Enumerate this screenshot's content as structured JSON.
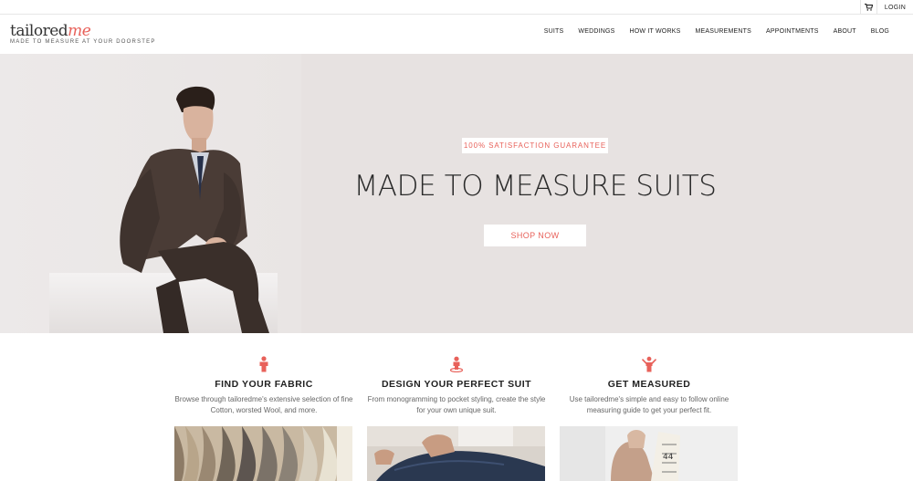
{
  "topbar": {
    "login": "LOGIN"
  },
  "header": {
    "logo_main": "tailored",
    "logo_accent": "me",
    "tagline": "MADE TO MEASURE AT YOUR DOORSTEP",
    "nav": [
      "SUITS",
      "WEDDINGS",
      "HOW IT WORKS",
      "MEASUREMENTS",
      "APPOINTMENTS",
      "ABOUT",
      "BLOG"
    ]
  },
  "hero": {
    "badge": "100% SATISFACTION GUARANTEE",
    "headline": "MADE TO MEASURE SUITS",
    "cta": "SHOP NOW"
  },
  "features": [
    {
      "icon": "person-icon",
      "title": "FIND YOUR FABRIC",
      "text": "Browse through tailoredme's extensive selection of fine Cotton, worsted Wool, and more."
    },
    {
      "icon": "location-pin-icon",
      "title": "DESIGN YOUR PERFECT SUIT",
      "text": "From monogramming to pocket styling, create the style for your own unique suit."
    },
    {
      "icon": "arms-raised-icon",
      "title": "GET MEASURED",
      "text": "Use tailoredme's simple and easy to follow online measuring guide to get your perfect fit."
    }
  ],
  "colors": {
    "accent": "#e8615a",
    "hero_bg": "#e7e2e1"
  }
}
